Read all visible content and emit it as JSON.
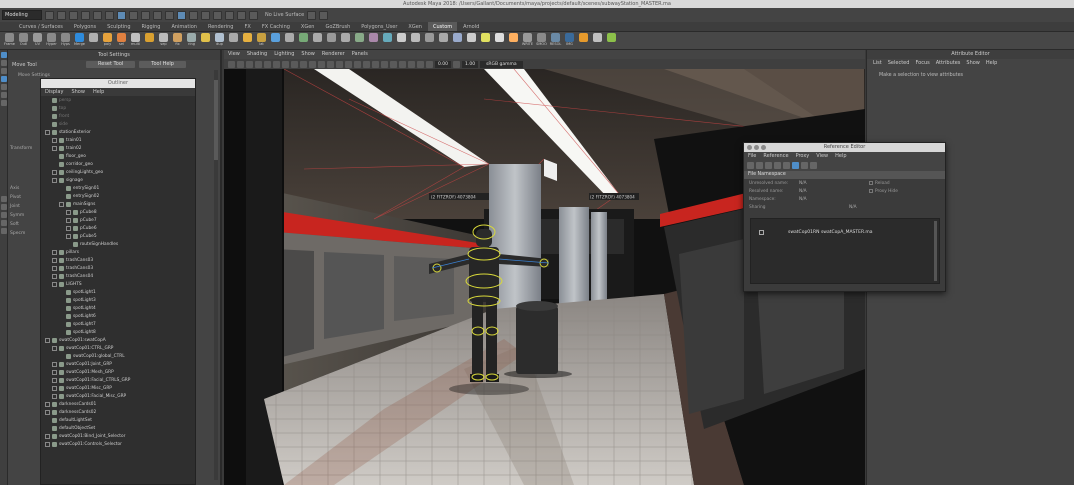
{
  "window": {
    "title": "Autodesk Maya 2018: /Users/Gallant/Documents/maya/projects/default/scenes/subwayStation_MASTER.ma"
  },
  "statusline": {
    "mode": "Modeling",
    "live_surface": "No Live Surface"
  },
  "shelf_tabs": [
    "Curves / Surfaces",
    "Polygons",
    "Sculpting",
    "Rigging",
    "Animation",
    "Rendering",
    "FX",
    "FX Caching",
    "XGen",
    "GoZBrush",
    "Polygons_User",
    "XGen",
    "Custom",
    "Arnold"
  ],
  "shelf_active": "Custom",
  "shelf_buttons": [
    {
      "label": "Frame",
      "color": "#8a8a8a"
    },
    {
      "label": "Outl",
      "color": "#8a8a8a"
    },
    {
      "label": "UV",
      "color": "#9a9a9a"
    },
    {
      "label": "Hyper",
      "color": "#8a8a8a"
    },
    {
      "label": "Hyps",
      "color": "#8a8a8a"
    },
    {
      "label": "Merge",
      "color": "#2e8bdc"
    },
    {
      "label": "",
      "color": "#b0b0b0"
    },
    {
      "label": "poly",
      "color": "#e6a23c"
    },
    {
      "label": "sel",
      "color": "#e08040"
    },
    {
      "label": "multi",
      "color": "#c0c0c0"
    },
    {
      "label": "",
      "color": "#d9a030"
    },
    {
      "label": "sep",
      "color": "#bbbbbb"
    },
    {
      "label": "fix",
      "color": "#d0a060"
    },
    {
      "label": "ring",
      "color": "#9aa"
    },
    {
      "label": "",
      "color": "#e0c04a"
    },
    {
      "label": "dup",
      "color": "#b0c0d0"
    },
    {
      "label": "",
      "color": "#aaaaaa"
    },
    {
      "label": "",
      "color": "#e6b040"
    },
    {
      "label": "lat",
      "color": "#c8a040"
    },
    {
      "label": "",
      "color": "#5aa0dd"
    },
    {
      "label": "",
      "color": "#aaa"
    },
    {
      "label": "",
      "color": "#7a7"
    },
    {
      "label": "",
      "color": "#aaa"
    },
    {
      "label": "",
      "color": "#999"
    },
    {
      "label": "",
      "color": "#aaa"
    },
    {
      "label": "",
      "color": "#8a8"
    },
    {
      "label": "",
      "color": "#a8a"
    },
    {
      "label": "",
      "color": "#6ab"
    },
    {
      "label": "",
      "color": "#ccc"
    },
    {
      "label": "",
      "color": "#bbb"
    },
    {
      "label": "",
      "color": "#999"
    },
    {
      "label": "",
      "color": "#aaa"
    },
    {
      "label": "",
      "color": "#9ac"
    },
    {
      "label": "",
      "color": "#ccc"
    },
    {
      "label": "",
      "color": "#e0e060"
    },
    {
      "label": "",
      "color": "#ddd"
    },
    {
      "label": "",
      "color": "#ffb060"
    },
    {
      "label": "WRITE",
      "color": "#9a9a9a"
    },
    {
      "label": "SMOO",
      "color": "#8a8a8a"
    },
    {
      "label": "RESOL",
      "color": "#6a8aa6"
    },
    {
      "label": "IMG",
      "color": "#3a6a9a"
    },
    {
      "label": "",
      "color": "#e69a2c"
    },
    {
      "label": "",
      "color": "#c0c0c0"
    },
    {
      "label": "",
      "color": "#8cc04a"
    }
  ],
  "tool_settings": {
    "header": "Tool Settings",
    "tool_name": "Move Tool",
    "reset_label": "Reset Tool",
    "help_label": "Tool Help",
    "side_labels": [
      "Move Settings",
      "Transform",
      "Axis",
      "Pivot",
      "Joint",
      "Symm",
      "Soft",
      "Specm"
    ]
  },
  "outliner": {
    "header": "Outliner",
    "menu": [
      "Display",
      "Show",
      "Help"
    ],
    "items": [
      {
        "label": "persp",
        "depth": 0,
        "exp": false,
        "dim": true
      },
      {
        "label": "top",
        "depth": 0,
        "exp": false,
        "dim": true
      },
      {
        "label": "front",
        "depth": 0,
        "exp": false,
        "dim": true
      },
      {
        "label": "side",
        "depth": 0,
        "exp": false,
        "dim": true
      },
      {
        "label": "stationExterior",
        "depth": 0,
        "exp": true,
        "dim": false
      },
      {
        "label": "train01",
        "depth": 1,
        "exp": true,
        "dim": false
      },
      {
        "label": "train02",
        "depth": 1,
        "exp": true,
        "dim": false
      },
      {
        "label": "floor_geo",
        "depth": 1,
        "exp": false,
        "dim": false
      },
      {
        "label": "corridor_geo",
        "depth": 1,
        "exp": false,
        "dim": false
      },
      {
        "label": "ceilingLights_geo",
        "depth": 1,
        "exp": true,
        "dim": false
      },
      {
        "label": "signage",
        "depth": 1,
        "exp": true,
        "dim": false
      },
      {
        "label": "entrySign01",
        "depth": 2,
        "exp": false,
        "dim": false
      },
      {
        "label": "entrySign02",
        "depth": 2,
        "exp": false,
        "dim": false
      },
      {
        "label": "mainSigns",
        "depth": 2,
        "exp": true,
        "dim": false
      },
      {
        "label": "pCube8",
        "depth": 3,
        "exp": true,
        "dim": false
      },
      {
        "label": "pCube7",
        "depth": 3,
        "exp": true,
        "dim": false
      },
      {
        "label": "pCube6",
        "depth": 3,
        "exp": true,
        "dim": false
      },
      {
        "label": "pCube5",
        "depth": 3,
        "exp": true,
        "dim": false
      },
      {
        "label": "routeSignHandles",
        "depth": 3,
        "exp": false,
        "dim": false
      },
      {
        "label": "pillars",
        "depth": 1,
        "exp": true,
        "dim": false
      },
      {
        "label": "trashCans03",
        "depth": 1,
        "exp": true,
        "dim": false
      },
      {
        "label": "trashCans03",
        "depth": 1,
        "exp": true,
        "dim": false
      },
      {
        "label": "trashCans04",
        "depth": 1,
        "exp": true,
        "dim": false
      },
      {
        "label": "LIGHTS",
        "depth": 1,
        "exp": true,
        "dim": false
      },
      {
        "label": "spotLight1",
        "depth": 2,
        "exp": false,
        "dim": false
      },
      {
        "label": "spotLight3",
        "depth": 2,
        "exp": false,
        "dim": false
      },
      {
        "label": "spotLight4",
        "depth": 2,
        "exp": false,
        "dim": false
      },
      {
        "label": "spotLight6",
        "depth": 2,
        "exp": false,
        "dim": false
      },
      {
        "label": "spotLight7",
        "depth": 2,
        "exp": false,
        "dim": false
      },
      {
        "label": "spotLight8",
        "depth": 2,
        "exp": false,
        "dim": false
      },
      {
        "label": "swatCop01:swatCopA",
        "depth": 0,
        "exp": true,
        "dim": false
      },
      {
        "label": "swatCop01:CTRL_GRP",
        "depth": 1,
        "exp": true,
        "dim": false
      },
      {
        "label": "swatCop01:global_CTRL",
        "depth": 2,
        "exp": false,
        "dim": false
      },
      {
        "label": "swatCop01:Joint_GRP",
        "depth": 1,
        "exp": true,
        "dim": false
      },
      {
        "label": "swatCop01:Mesh_GRP",
        "depth": 1,
        "exp": true,
        "dim": false
      },
      {
        "label": "swatCop01:Facial_CTRLS_GRP",
        "depth": 1,
        "exp": true,
        "dim": false
      },
      {
        "label": "swatCop01:Misc_GRP",
        "depth": 1,
        "exp": true,
        "dim": false
      },
      {
        "label": "swatCop01:Facial_Misc_GRP",
        "depth": 1,
        "exp": true,
        "dim": false
      },
      {
        "label": "darknessCards01",
        "depth": 0,
        "exp": true,
        "dim": false
      },
      {
        "label": "darknessCards02",
        "depth": 0,
        "exp": true,
        "dim": false
      },
      {
        "label": "defaultLightSet",
        "depth": 0,
        "exp": false,
        "dim": false
      },
      {
        "label": "defaultObjectSet",
        "depth": 0,
        "exp": false,
        "dim": false
      },
      {
        "label": "swatCop01:Bind_Joint_Selector",
        "depth": 0,
        "exp": true,
        "dim": false
      },
      {
        "label": "swatCop01:Controls_Selector",
        "depth": 0,
        "exp": true,
        "dim": false
      }
    ]
  },
  "viewport": {
    "menu": [
      "View",
      "Shading",
      "Lighting",
      "Show",
      "Renderer",
      "Panels"
    ],
    "val1": "0.00",
    "val2": "1.00",
    "gamma": "sRGB gamma",
    "signs": [
      "(2 FITZROY) 4073804",
      "(2 FITZROY) 4073804",
      "(2 FITZROY) 4073804"
    ]
  },
  "attribute_editor": {
    "header": "Attribute Editor",
    "menu": [
      "List",
      "Selected",
      "Focus",
      "Attributes",
      "Show",
      "Help"
    ],
    "hint": "Make a selection to view attributes"
  },
  "reference_editor": {
    "title": "Reference Editor",
    "menu": [
      "File",
      "Reference",
      "Proxy",
      "View",
      "Help"
    ],
    "section": "File Namespace",
    "rows": [
      {
        "k": "Unresolved name:",
        "v": "N/A"
      },
      {
        "k": "Resolved name:",
        "v": "N/A"
      },
      {
        "k": "Namespace:",
        "v": "N/A"
      },
      {
        "k": "Sharing",
        "v": "N/A"
      }
    ],
    "reload_label": "Reload",
    "proxy_label": "Proxy Hide",
    "file_entry": "swatCop01RN  swatCopA_MASTER.ma"
  },
  "colors": {
    "ui_bg": "#444444",
    "accent_blue": "#4f8ec9",
    "train_red": "#c8251f",
    "wire_yellow": "#d9d93a"
  }
}
